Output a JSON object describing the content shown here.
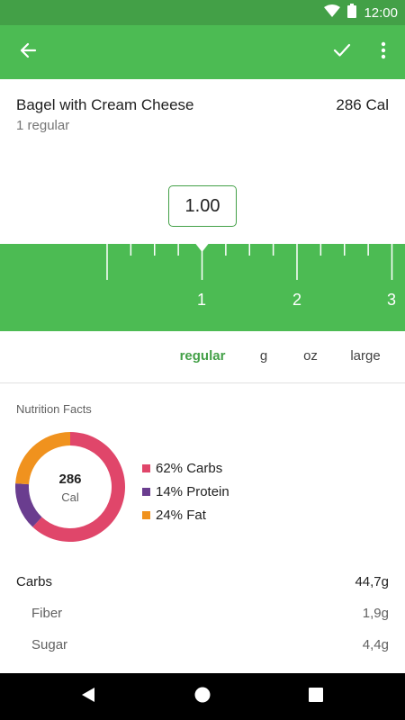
{
  "status_bar": {
    "time": "12:00",
    "icons": [
      "wifi-icon",
      "battery-icon"
    ]
  },
  "toolbar": {
    "back_icon": "arrow-left-icon",
    "confirm_icon": "check-icon",
    "menu_icon": "more-vert-icon"
  },
  "food": {
    "name": "Bagel with Cream Cheese",
    "calories": "286 Cal",
    "serving": "1 regular"
  },
  "quantity": {
    "value": "1.00"
  },
  "ruler": {
    "labels": [
      "1",
      "2",
      "3"
    ],
    "current_value": 1.0
  },
  "units": {
    "items": [
      "regular",
      "g",
      "oz",
      "large"
    ],
    "selected": "regular"
  },
  "nutrition": {
    "title": "Nutrition Facts",
    "total_calories": "286",
    "calories_unit": "Cal",
    "breakdown": [
      {
        "label": "62% Carbs",
        "percent": 62,
        "color": "#e0466a"
      },
      {
        "label": "14% Protein",
        "percent": 14,
        "color": "#6a3d8f"
      },
      {
        "label": "24% Fat",
        "percent": 24,
        "color": "#f0921e"
      }
    ],
    "rows": [
      {
        "label": "Carbs",
        "value": "44,7g",
        "sub": false
      },
      {
        "label": "Fiber",
        "value": "1,9g",
        "sub": true
      },
      {
        "label": "Sugar",
        "value": "4,4g",
        "sub": true
      }
    ]
  },
  "nav_bar": {
    "back_icon": "nav-back-icon",
    "home_icon": "nav-home-icon",
    "recents_icon": "nav-recents-icon"
  },
  "colors": {
    "primary": "#4cbb53",
    "primary_dark": "#43a047",
    "carbs": "#e0466a",
    "protein": "#6a3d8f",
    "fat": "#f0921e"
  }
}
